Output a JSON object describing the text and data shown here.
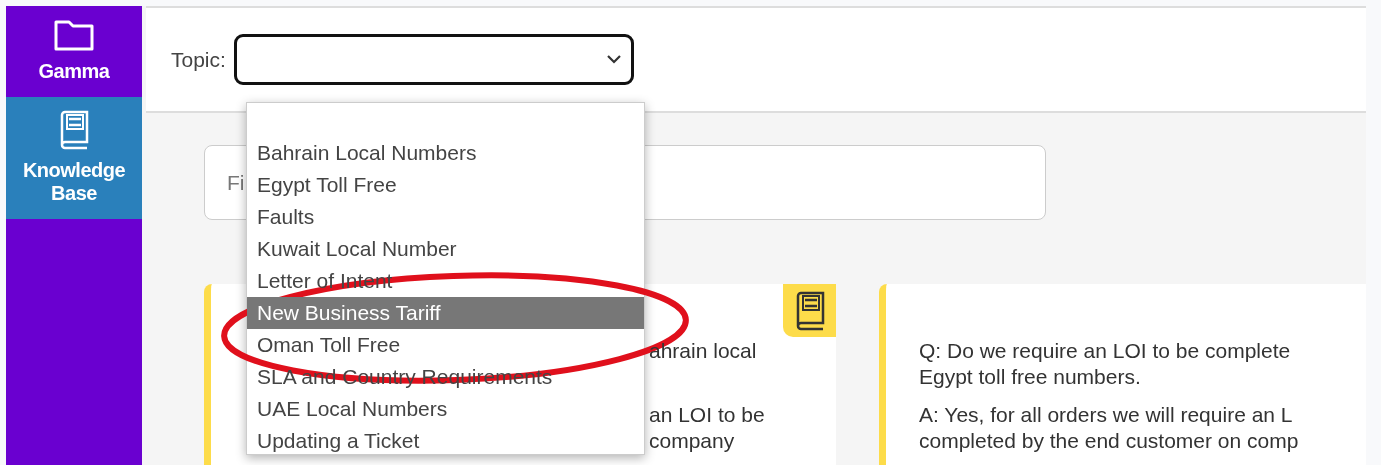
{
  "sidebar": {
    "items": [
      {
        "label": "Gamma",
        "kind": "folder",
        "selected": false
      },
      {
        "label": "Knowledge Base",
        "kind": "book",
        "selected": true
      }
    ]
  },
  "topic": {
    "label": "Topic:",
    "options": [
      {
        "label": "Bahrain Local Numbers",
        "selected": false
      },
      {
        "label": "Egypt Toll Free",
        "selected": false
      },
      {
        "label": "Faults",
        "selected": false
      },
      {
        "label": "Kuwait Local Number",
        "selected": false
      },
      {
        "label": "Letter of Intent",
        "selected": false
      },
      {
        "label": "New Business Tariff",
        "selected": true
      },
      {
        "label": "Oman Toll Free",
        "selected": false
      },
      {
        "label": "SLA and Country Requirements",
        "selected": false
      },
      {
        "label": "UAE Local Numbers",
        "selected": false
      },
      {
        "label": "Updating a Ticket",
        "selected": false
      }
    ]
  },
  "filter": {
    "placeholder": "Fi"
  },
  "cards": [
    {
      "badge": true,
      "lines": [
        "ahrain local",
        "an LOI to be",
        "company"
      ]
    },
    {
      "badge": false,
      "lines": [
        "Q: Do we require an LOI to be complete",
        "Egypt toll free numbers.",
        "A: Yes, for all orders we will require an L",
        "completed by the end customer on comp"
      ]
    }
  ]
}
